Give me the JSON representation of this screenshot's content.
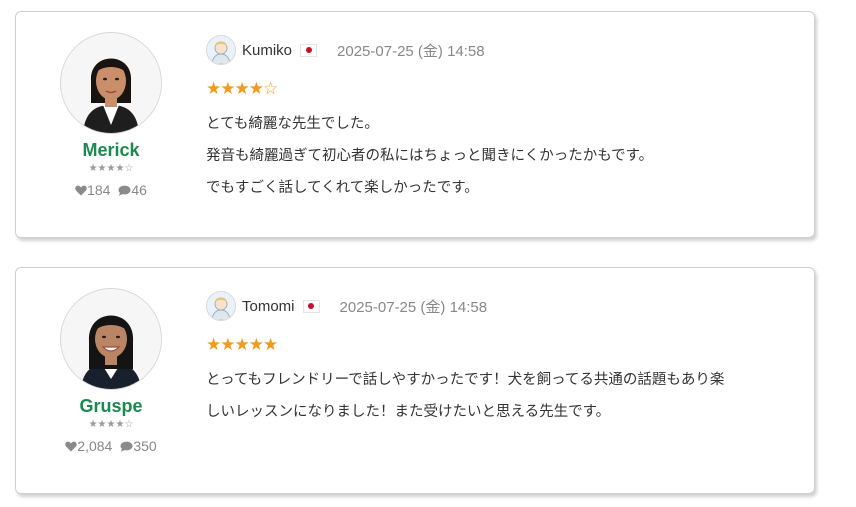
{
  "reviews": [
    {
      "teacher_name": "Merick",
      "teacher_rating_icon": "star-rating-4.5",
      "likes": "184",
      "comments": "46",
      "reviewer_name": "Kumiko",
      "reviewer_flag": "japan-flag-icon",
      "date": "2025-07-25 (金) 14:58",
      "rating": 4.5,
      "stars_text": "★★★★☆",
      "lines": [
        "とても綺麗な先生でした。",
        "発音も綺麗過ぎて初心者の私にはちょっと聞きにくかったかもです。",
        "でもすごく話してくれて楽しかったです。"
      ]
    },
    {
      "teacher_name": "Gruspe",
      "teacher_rating_icon": "star-rating-4.5",
      "likes": "2,084",
      "comments": "350",
      "reviewer_name": "Tomomi",
      "reviewer_flag": "japan-flag-icon",
      "date": "2025-07-25 (金) 14:58",
      "rating": 5,
      "stars_text": "★★★★★",
      "lines": [
        "とってもフレンドリーで話しやすかったです！犬を飼ってる共通の話題もあり楽",
        "しいレッスンになりました！また受けたいと思える先生です。"
      ]
    }
  ],
  "colors": {
    "teacher_name": "#1b8a4f",
    "star": "#f39a1b",
    "meta": "#888888"
  }
}
